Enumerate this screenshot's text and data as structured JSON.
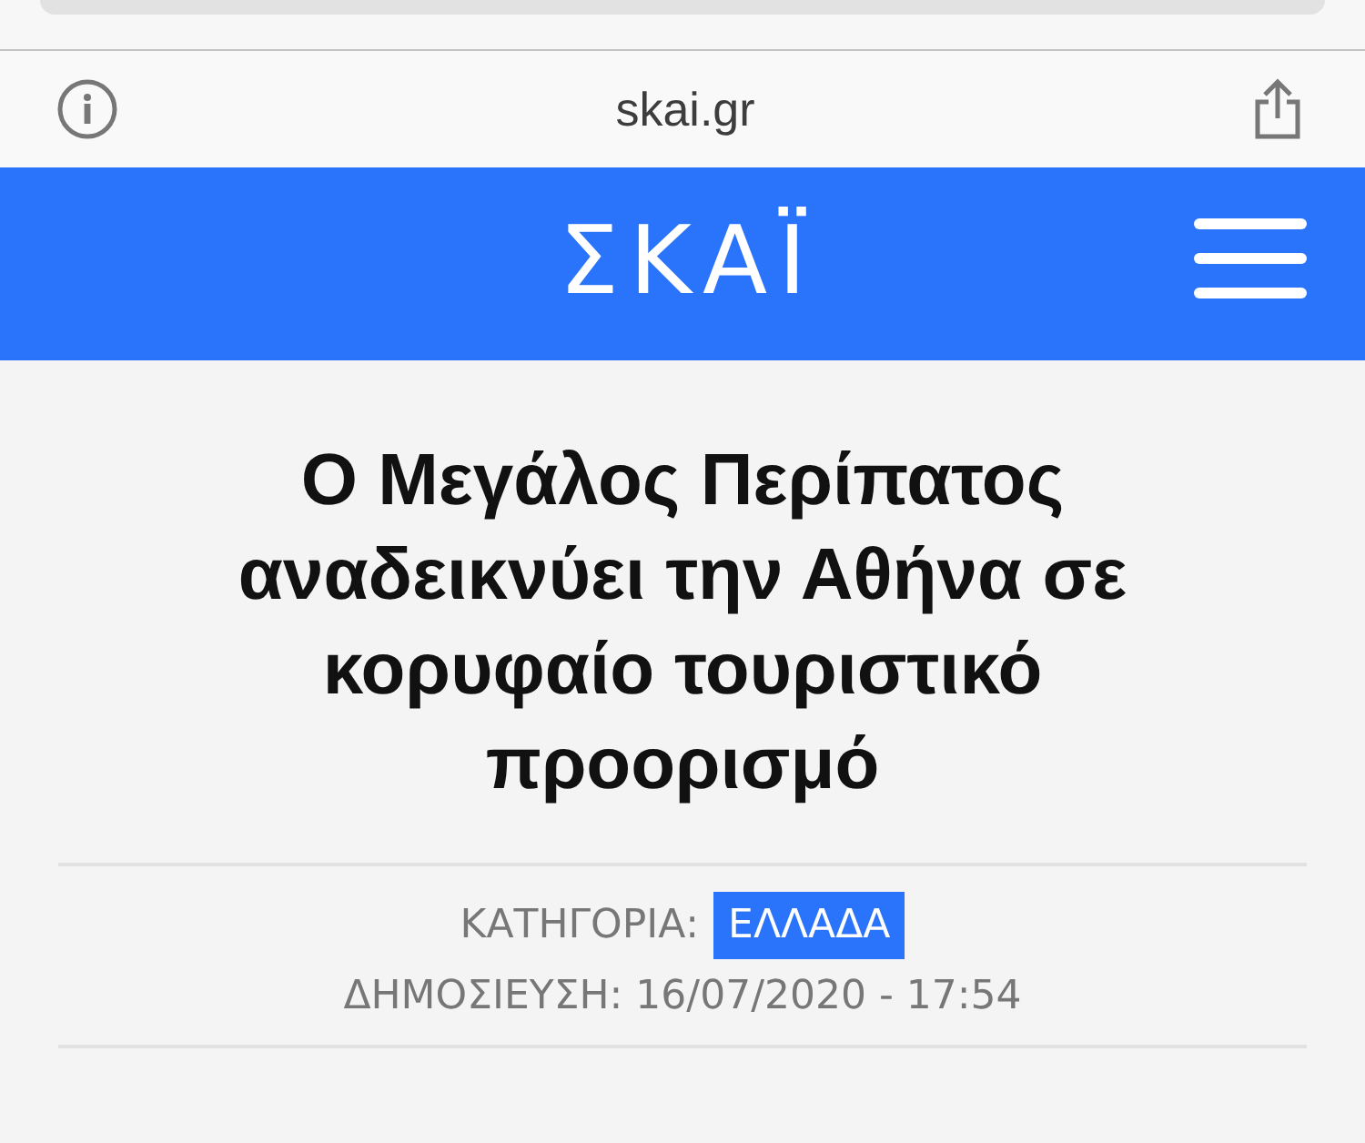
{
  "address_bar": {
    "url": "skai.gr"
  },
  "header": {
    "logo": "ΣΚΑΪ"
  },
  "article": {
    "title": "Ο Μεγάλος Περίπατος αναδεικνύει την Αθήνα σε κορυφαίο τουριστικό προορισμό",
    "category_label": "ΚΑΤΗΓΟΡΙΑ:",
    "category": "ΕΛΛΑΔΑ",
    "published": "ΔΗΜΟΣΙΕΥΣΗ: 16/07/2020 - 17:54"
  }
}
